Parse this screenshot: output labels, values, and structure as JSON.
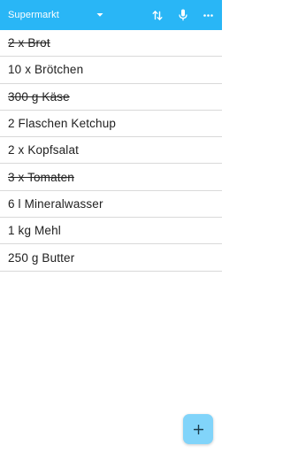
{
  "toolbar": {
    "list_name": "Supermarkt",
    "background_color": "#29b6f6",
    "icons": {
      "dropdown": "dropdown-icon",
      "sort": "sort-icon",
      "mic": "microphone-icon",
      "more": "more-vert-icon"
    }
  },
  "items": [
    {
      "label": "2 x Brot",
      "checked": true
    },
    {
      "label": "10 x Brötchen",
      "checked": false
    },
    {
      "label": "300 g Käse",
      "checked": true
    },
    {
      "label": "2 Flaschen Ketchup",
      "checked": false
    },
    {
      "label": "2 x Kopfsalat",
      "checked": false
    },
    {
      "label": "3 x Tomaten",
      "checked": true
    },
    {
      "label": "6 l Mineralwasser",
      "checked": false
    },
    {
      "label": "1 kg Mehl",
      "checked": false
    },
    {
      "label": "250 g Butter",
      "checked": false
    }
  ],
  "fab": {
    "icon": "add-icon",
    "color": "#81d4fa"
  }
}
